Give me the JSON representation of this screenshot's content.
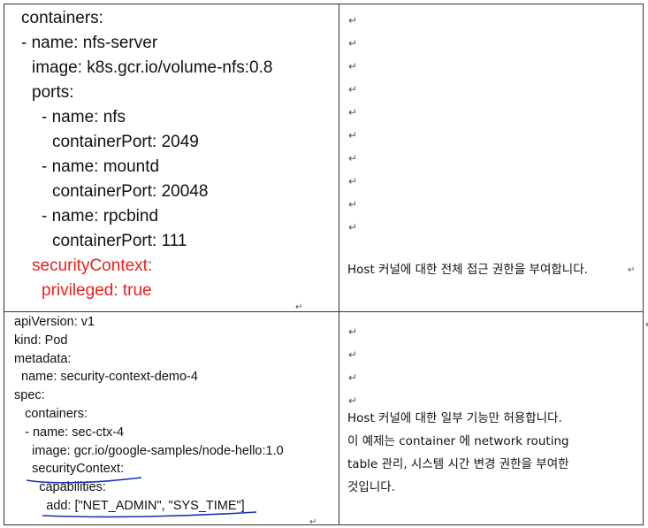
{
  "top": {
    "code_lines": [
      {
        "text": "containers:",
        "indent": 0,
        "highlight": false
      },
      {
        "text": "- name: nfs-server",
        "indent": 0,
        "highlight": false
      },
      {
        "text": "image: k8s.gcr.io/volume-nfs:0.8",
        "indent": 1,
        "highlight": false
      },
      {
        "text": "ports:",
        "indent": 1,
        "highlight": false
      },
      {
        "text": "- name: nfs",
        "indent": 2,
        "highlight": false
      },
      {
        "text": "containerPort: 2049",
        "indent": 3,
        "highlight": false
      },
      {
        "text": "- name: mountd",
        "indent": 2,
        "highlight": false
      },
      {
        "text": "containerPort: 20048",
        "indent": 3,
        "highlight": false
      },
      {
        "text": "- name: rpcbind",
        "indent": 2,
        "highlight": false
      },
      {
        "text": "containerPort: 111",
        "indent": 3,
        "highlight": false
      },
      {
        "text": "securityContext:",
        "indent": 1,
        "highlight": true
      },
      {
        "text": "privileged: true",
        "indent": 2,
        "highlight": true
      }
    ],
    "description": "Host 커널에 대한 전체 접근 권한을 부여합니다.",
    "marker": "↵"
  },
  "bottom": {
    "code_lines": [
      "apiVersion: v1",
      "kind: Pod",
      "metadata:",
      "  name: security-context-demo-4",
      "spec:",
      "   containers:",
      "   - name: sec-ctx-4",
      "     image: gcr.io/google-samples/node-hello:1.0",
      "     securityContext:",
      "       capabilities:",
      "         add: [\"NET_ADMIN\", \"SYS_TIME\"]"
    ],
    "description_lines": [
      "Host 커널에 대한 일부 기능만 허용합니다.",
      "이 예제는 container 에 network routing",
      "table 관리, 시스템 시간 변경 권한을 부여한",
      "것입니다."
    ],
    "marker": "↵"
  },
  "colors": {
    "highlight": "#e8201e",
    "annotation": "#1a2fb0",
    "border": "#333333"
  }
}
